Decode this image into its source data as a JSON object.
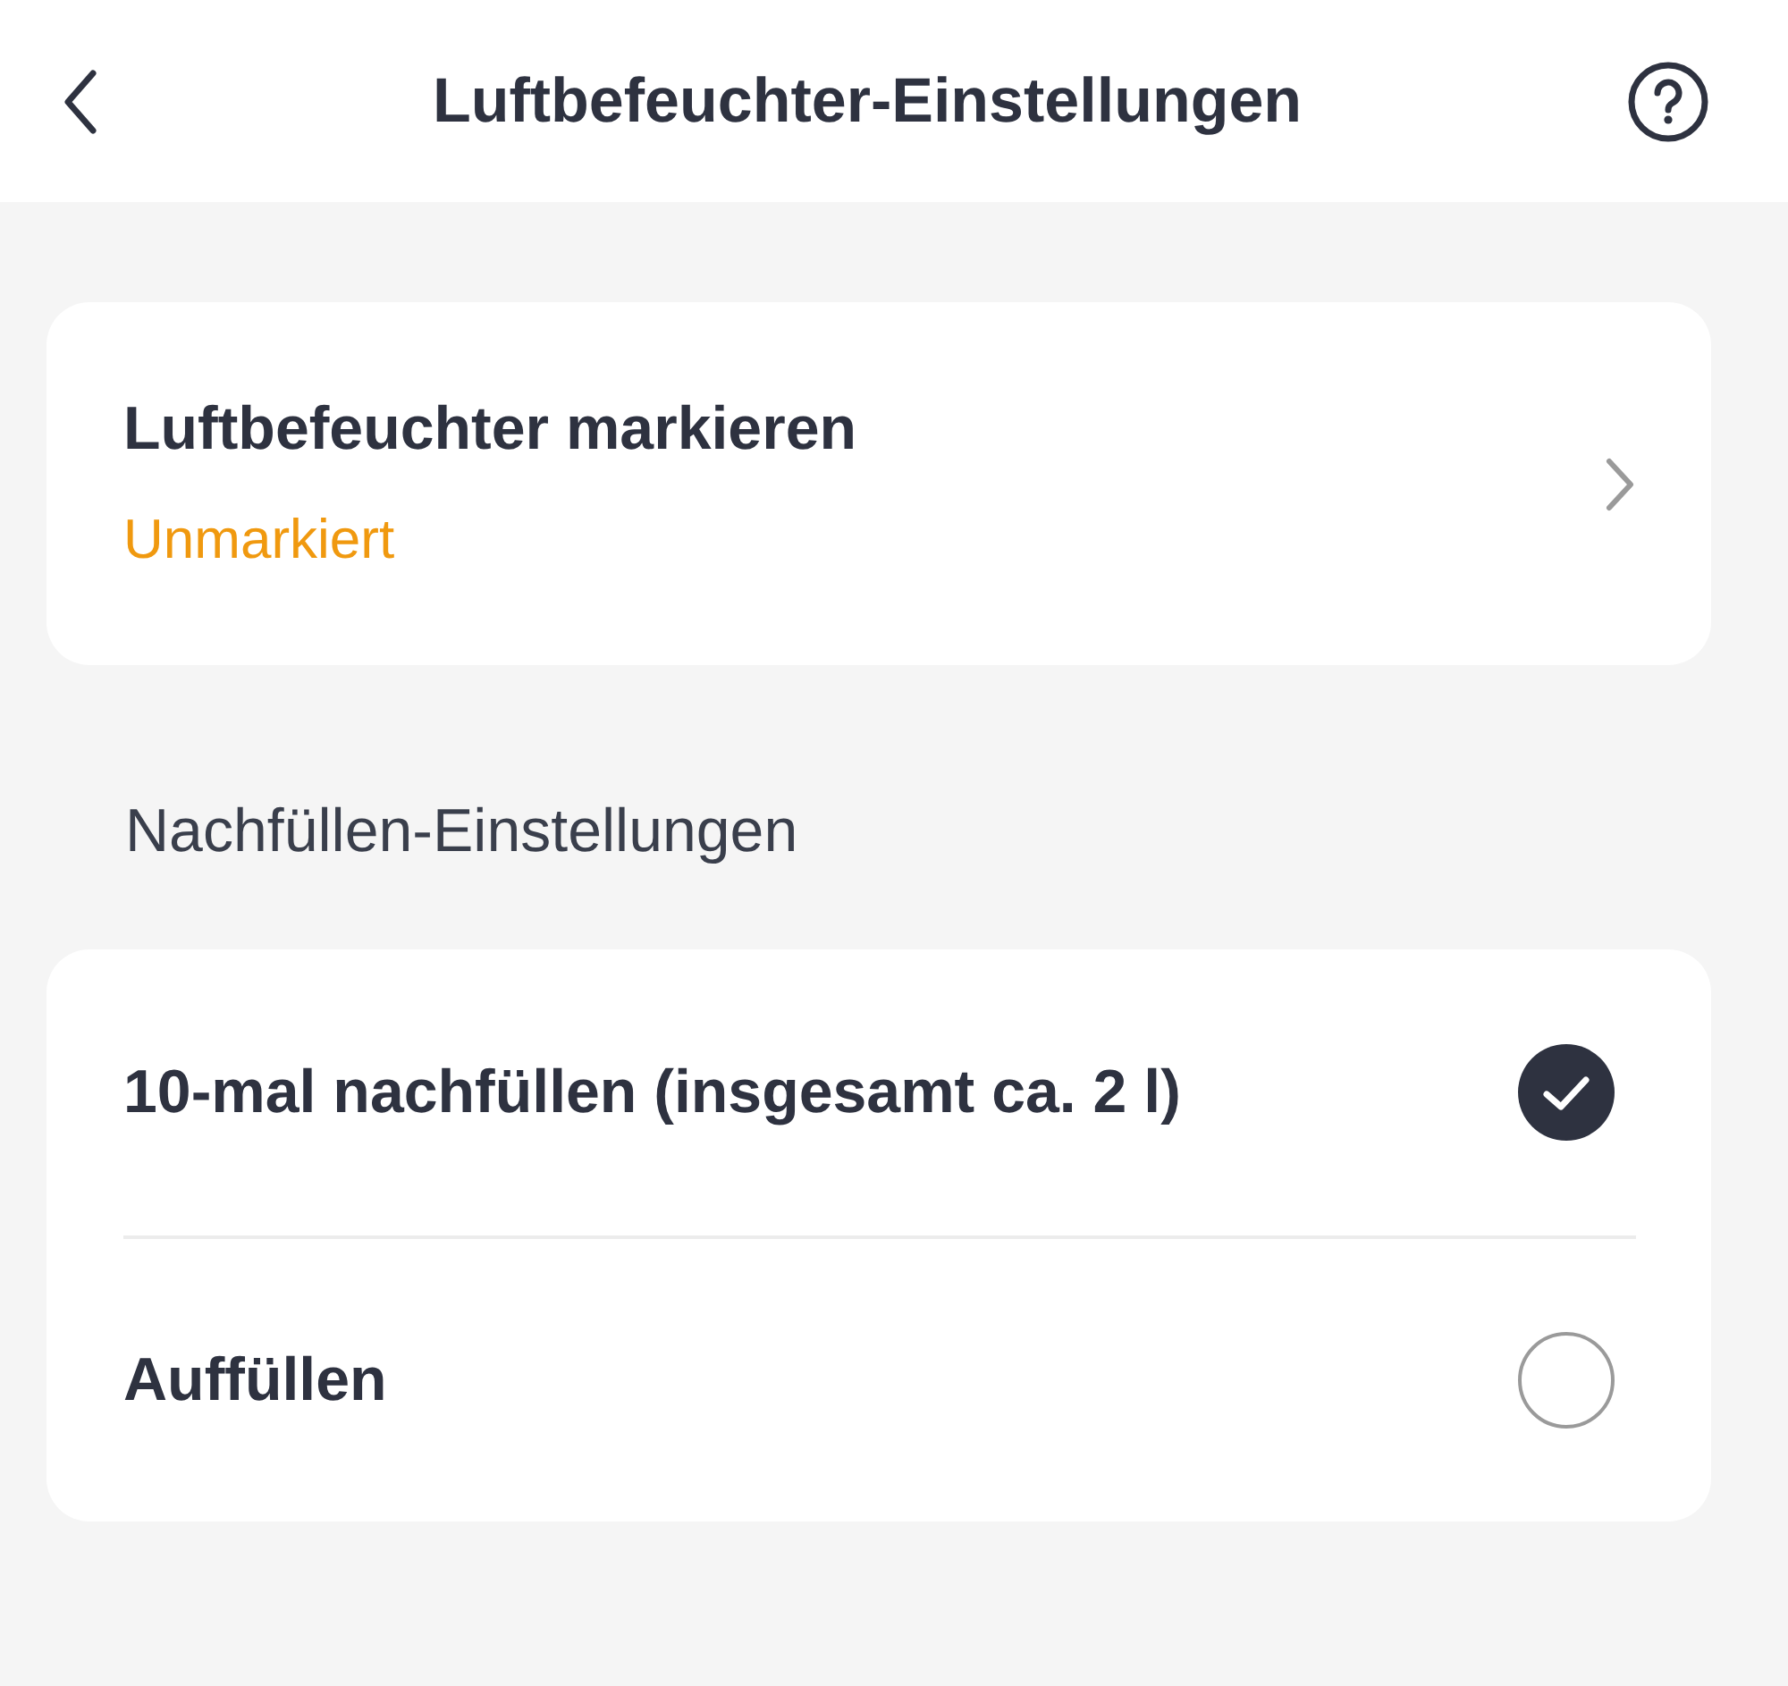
{
  "header": {
    "title": "Luftbefeuchter-Einstellungen"
  },
  "mark_card": {
    "title": "Luftbefeuchter markieren",
    "status": "Unmarkiert"
  },
  "refill_section": {
    "heading": "Nachfüllen-Einstellungen",
    "options": [
      {
        "label": "10-mal nachfüllen (insgesamt ca. 2 l)",
        "selected": true
      },
      {
        "label": "Auffüllen",
        "selected": false
      }
    ]
  }
}
